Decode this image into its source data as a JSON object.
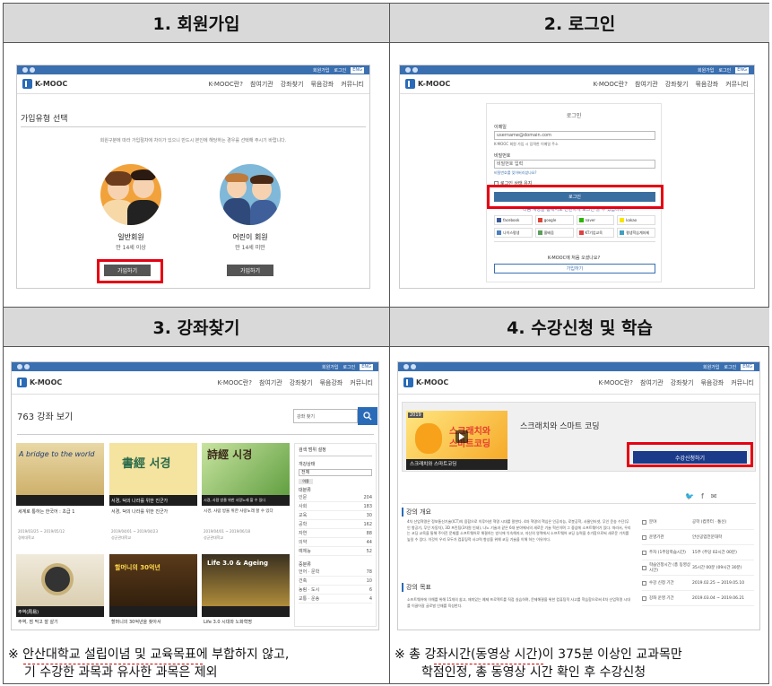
{
  "headers": [
    "1. 회원가입",
    "2. 로그인",
    "3. 강좌찾기",
    "4. 수강신청 및 학습"
  ],
  "site": {
    "logo": "K-MOOC",
    "menu": [
      "K-MOOC란?",
      "참여기관",
      "강좌찾기",
      "묶음강좌",
      "커뮤니티"
    ],
    "toplinks": [
      "회원가입",
      "로그인"
    ],
    "eng": "ENG"
  },
  "panel1": {
    "title": "가입유형 선택",
    "desc": "회원구분에 따라 가입절차에 차이가 있으니 반드시 본인에 해당하는 경우를 선택해 주시기 바랍니다.",
    "general": {
      "label": "일반회원",
      "sub": "만 14세 이상",
      "button": "가입하기"
    },
    "child": {
      "label": "어린이 회원",
      "sub": "만 14세 미만",
      "button": "가입하기"
    }
  },
  "panel2": {
    "title": "로그인",
    "email_label": "이메일",
    "email_placeholder": "username@domain.com",
    "email_hint": "K-MOOC 회원 가입 시 입력한 이메일 주소",
    "pw_label": "비밀번호",
    "pw_placeholder": "비밀번호 입력",
    "forgot": "비밀번호를 잊어버리셨나요?",
    "remember": "로그인 상태 유지",
    "login_button": "로그인",
    "social_caption": "다음 계정을 통해서도 간편하게 로그인 할 수 있습니다.",
    "social": [
      "facebook",
      "google",
      "naver",
      "kakao",
      "나이스평생",
      "올배움",
      "KT기업교육",
      "평생학습계좌제"
    ],
    "new_q": "K-MOOC에 처음 오셨나요?",
    "signup_button": "가입하기"
  },
  "panel3": {
    "count_title": "763 강좌 보기",
    "search_placeholder": "강좌 찾기",
    "filter_title": "검색 범위 설정",
    "status_label": "개강상태",
    "status_value": "전체",
    "tag": "이용",
    "category_title": "대분류",
    "categories": [
      {
        "name": "인문",
        "count": "204"
      },
      {
        "name": "사회",
        "count": "183"
      },
      {
        "name": "교육",
        "count": "30"
      },
      {
        "name": "공학",
        "count": "162"
      },
      {
        "name": "자연",
        "count": "88"
      },
      {
        "name": "의약",
        "count": "44"
      },
      {
        "name": "예체능",
        "count": "52"
      }
    ],
    "sub_title": "중분류",
    "subcategories": [
      {
        "name": "언어 · 문학",
        "count": "78"
      },
      {
        "name": "건축",
        "count": "10"
      },
      {
        "name": "농림 · 도시",
        "count": "6"
      },
      {
        "name": "교통 · 운송",
        "count": "4"
      }
    ],
    "courses": [
      {
        "thumb": "A bridge to the world",
        "title": "세계로 통하는 한국어 : 초급 1",
        "date": "2019/03/25 ~ 2019/05/12",
        "org": "경희대학교"
      },
      {
        "thumb": "書經 서경",
        "title": "서경, 덕의 나라를 위한 진군가",
        "date": "2019/04/01 ~ 2019/04/23",
        "org": "성균관대학교"
      },
      {
        "thumb": "詩經 시경",
        "title": "시경, 사람 방울 위한 사랑노래 할 수 있다",
        "date": "2019/04/01 ~ 2019/06/18",
        "org": "성균관대학교"
      },
      {
        "thumb": "주역(周易)",
        "title": "주역, 점 막고 잘 살기",
        "date": "",
        "org": ""
      },
      {
        "thumb": "할머니의 30억년",
        "title": "할머니의 30억년을 찾아서",
        "date": "",
        "org": ""
      },
      {
        "thumb": "Life 3.0 & Ageing",
        "title": "Life 3.0 시대와 노화혁명",
        "date": "",
        "org": ""
      }
    ]
  },
  "panel4": {
    "course_title": "스크래치와 스마트 코딩",
    "thumb_title": "스크래치와 스마트코딩",
    "thumb_year": "2019",
    "enroll_button": "수강신청하기",
    "overview_title": "강의 개요",
    "overview_text": "4차 산업혁명은 정보통신기술(ICT)의 융합으로 이루어낸 혁명 시대를 말한다. 4차 혁명의 핵심은 인공지능, 로봇공학, 사물인터넷, 무인 운송 수단(무인 항공기, 무인 자동차), 3D 프린팅(3차원 인쇄), 나노 기술과 같은 6대 분야에서의 새로운 기술 혁신이며 그 중심에 소프트웨어가 있다. 따라서, 우리는 코딩 교육을 통해 주어진 문제를 소프트웨어로 해결하는 방식에 익숙해지고, 자신의 영역에서 소프트웨어 코딩 능력을 추가함으로써 새로운 가치를 높일 수 있다. 이것이 우리 모두가 컴퓨팅적 사고력 향상을 위해 코딩 기술을 이해 하는 이유이다.",
    "goal_title": "강의 목표",
    "goal_text": "소프트웨어에 이해를 위해 15개의 쉽고, 재미있는 예제 프로젝트를 직접 실습하며, 문제해결을 위한 컴퓨팅적 사고를 학습함으로써 4차 산업혁명 시대를 이끌어갈 글로벌 인재를 육성한다.",
    "info": [
      {
        "label": "분야",
        "value": "공학 (컴퓨터 · 통신)"
      },
      {
        "label": "운영기관",
        "value": "안산공업전문대학"
      },
      {
        "label": "주차 (1주당학습시간)",
        "value": "15주 (주당 02시간 00분)"
      },
      {
        "label": "학습인정시간 (총 동영상시간)",
        "value": "35시간 00분 (09시간 30분)"
      },
      {
        "label": "수강 신청 기간",
        "value": "2019.02.25 ~ 2019.05.10"
      },
      {
        "label": "강좌 운영 기간",
        "value": "2019.03.04 ~ 2019.06.21"
      }
    ]
  },
  "notes": {
    "left": "※ 안산대학교 설립이념 및 교육목표에 부합하지 않고, 기 수강한 과목과 유사한 과목은 제외",
    "left_line1": "※ 안산대학교 설립이념 및 교육목표에 부합하지 않고,",
    "left_line2": "기 수강한 과목과 유사한 과목은 제외",
    "right_line1": "※ 총 강좌시간(동영상 시간)이 375분 이상인 교과목만",
    "right_line2": "학점인정, 총 동영상 시간 확인 후 수강신청"
  },
  "colors": {
    "header_bg": "#d9d9d9",
    "highlight": "#e60012",
    "brand": "#3a6fb0"
  }
}
